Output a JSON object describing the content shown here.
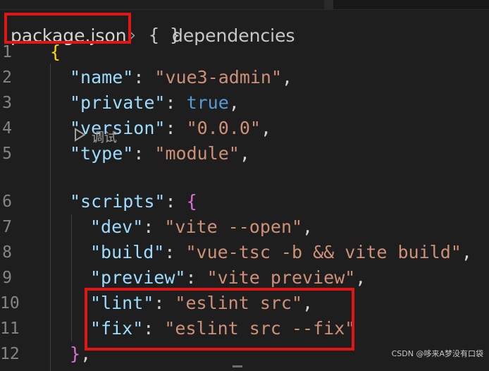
{
  "breadcrumb": {
    "file": "package.json",
    "separator": "›",
    "symbol_icon": "{ }",
    "symbol": "dependencies"
  },
  "codelens": {
    "label": "调试",
    "icon": "play-icon"
  },
  "watermark": "CSDN @哆来A梦没有口袋",
  "lines": [
    {
      "num": "1"
    },
    {
      "num": "2",
      "key": "\"name\"",
      "value": "\"vue3-admin\""
    },
    {
      "num": "3",
      "key": "\"private\"",
      "value": "true"
    },
    {
      "num": "4",
      "key": "\"version\"",
      "value": "\"0.0.0\""
    },
    {
      "num": "5",
      "key": "\"type\"",
      "value": "\"module\""
    },
    {
      "num": "6",
      "key": "\"scripts\""
    },
    {
      "num": "7",
      "key": "\"dev\"",
      "value": "\"vite --open\""
    },
    {
      "num": "8",
      "key": "\"build\"",
      "value": "\"vue-tsc -b && vite build\""
    },
    {
      "num": "9",
      "key": "\"preview\"",
      "value": "\"vite preview\""
    },
    {
      "num": "10",
      "key": "\"lint\"",
      "value": "\"eslint src\""
    },
    {
      "num": "11",
      "key": "\"fix\"",
      "value": "\"eslint src --fix\""
    },
    {
      "num": "12"
    }
  ],
  "colors": {
    "key": "#9cdcfe",
    "string": "#ce9178",
    "boolean": "#569cd6",
    "highlight_box": "#e01515"
  }
}
